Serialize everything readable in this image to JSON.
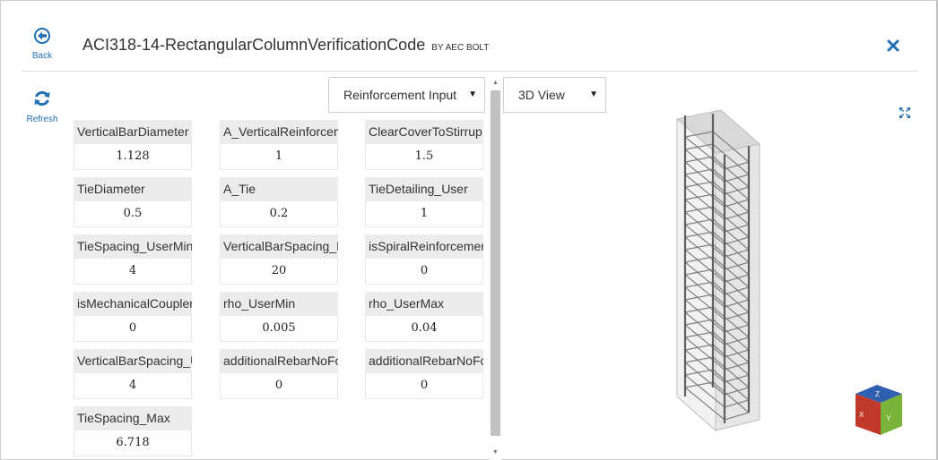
{
  "header": {
    "back_label": "Back",
    "refresh_label": "Refresh",
    "title": "ACI318-14-RectangularColumnVerificationCode",
    "title_by": "BY AEC BOLT"
  },
  "toolbar": {
    "input_select": "Reinforcement Input",
    "view_select": "3D View"
  },
  "params": [
    {
      "name": "VerticalBarDiameter",
      "value": "1.128"
    },
    {
      "name": "A_VerticalReinforcement",
      "value": "1"
    },
    {
      "name": "ClearCoverToStirrup",
      "value": "1.5"
    },
    {
      "name": "TieDiameter",
      "value": "0.5"
    },
    {
      "name": "A_Tie",
      "value": "0.2"
    },
    {
      "name": "TieDetailing_User",
      "value": "1"
    },
    {
      "name": "TieSpacing_UserMin",
      "value": "4"
    },
    {
      "name": "VerticalBarSpacing_Max",
      "value": "20"
    },
    {
      "name": "isSpiralReinforcemen",
      "value": "0"
    },
    {
      "name": "isMechanicalCouplerUsed",
      "value": "0"
    },
    {
      "name": "rho_UserMin",
      "value": "0.005"
    },
    {
      "name": "rho_UserMax",
      "value": "0.04"
    },
    {
      "name": "VerticalBarSpacing_UserMin",
      "value": "4"
    },
    {
      "name": "additionalRebarNoForW",
      "value": "0"
    },
    {
      "name": "additionalRebarNoFo",
      "value": "0"
    },
    {
      "name": "TieSpacing_Max",
      "value": "6.718"
    }
  ],
  "view_cube": {
    "top": "Z",
    "left": "X",
    "right": "Y"
  },
  "colors": {
    "accent": "#1f6fb5",
    "cube_top": "#2f5fb0",
    "cube_left": "#c0392b",
    "cube_right": "#7ab33a"
  }
}
